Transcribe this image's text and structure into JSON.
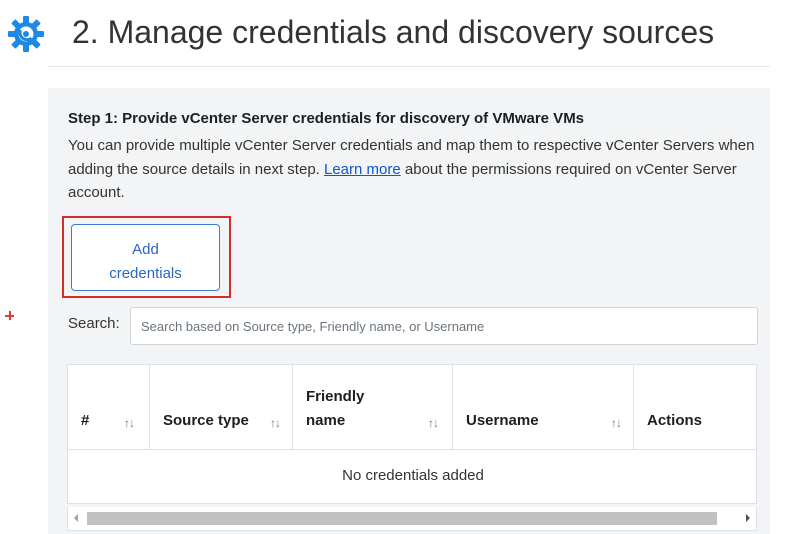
{
  "header": {
    "title": "2. Manage credentials and discovery sources",
    "icon": "gear-icon",
    "icon_color": "#1e88e5"
  },
  "step1": {
    "title": "Step 1: Provide vCenter Server credentials for discovery of VMware VMs",
    "description_before_link": "You can provide multiple vCenter Server credentials and map them to respective vCenter Servers when adding the source details in next step. ",
    "link_text": "Learn more",
    "description_after_link": " about the permissions required on vCenter Server account.",
    "add_button_line1": "Add",
    "add_button_line2": "credentials"
  },
  "search": {
    "label": "Search:",
    "placeholder": "Search based on Source type, Friendly name, or Username"
  },
  "table": {
    "columns": [
      {
        "line1": "#",
        "line2": ""
      },
      {
        "line1": "Source type",
        "line2": ""
      },
      {
        "line1": "Friendly",
        "line2": "name"
      },
      {
        "line1": "Username",
        "line2": ""
      },
      {
        "line1": "Actions",
        "line2": ""
      }
    ],
    "sort_glyph": "↑↓",
    "empty_message": "No credentials added"
  },
  "colors": {
    "accent": "#2b66c2",
    "highlight_border": "#d62b2b",
    "panel_bg": "#f3f4f5"
  }
}
